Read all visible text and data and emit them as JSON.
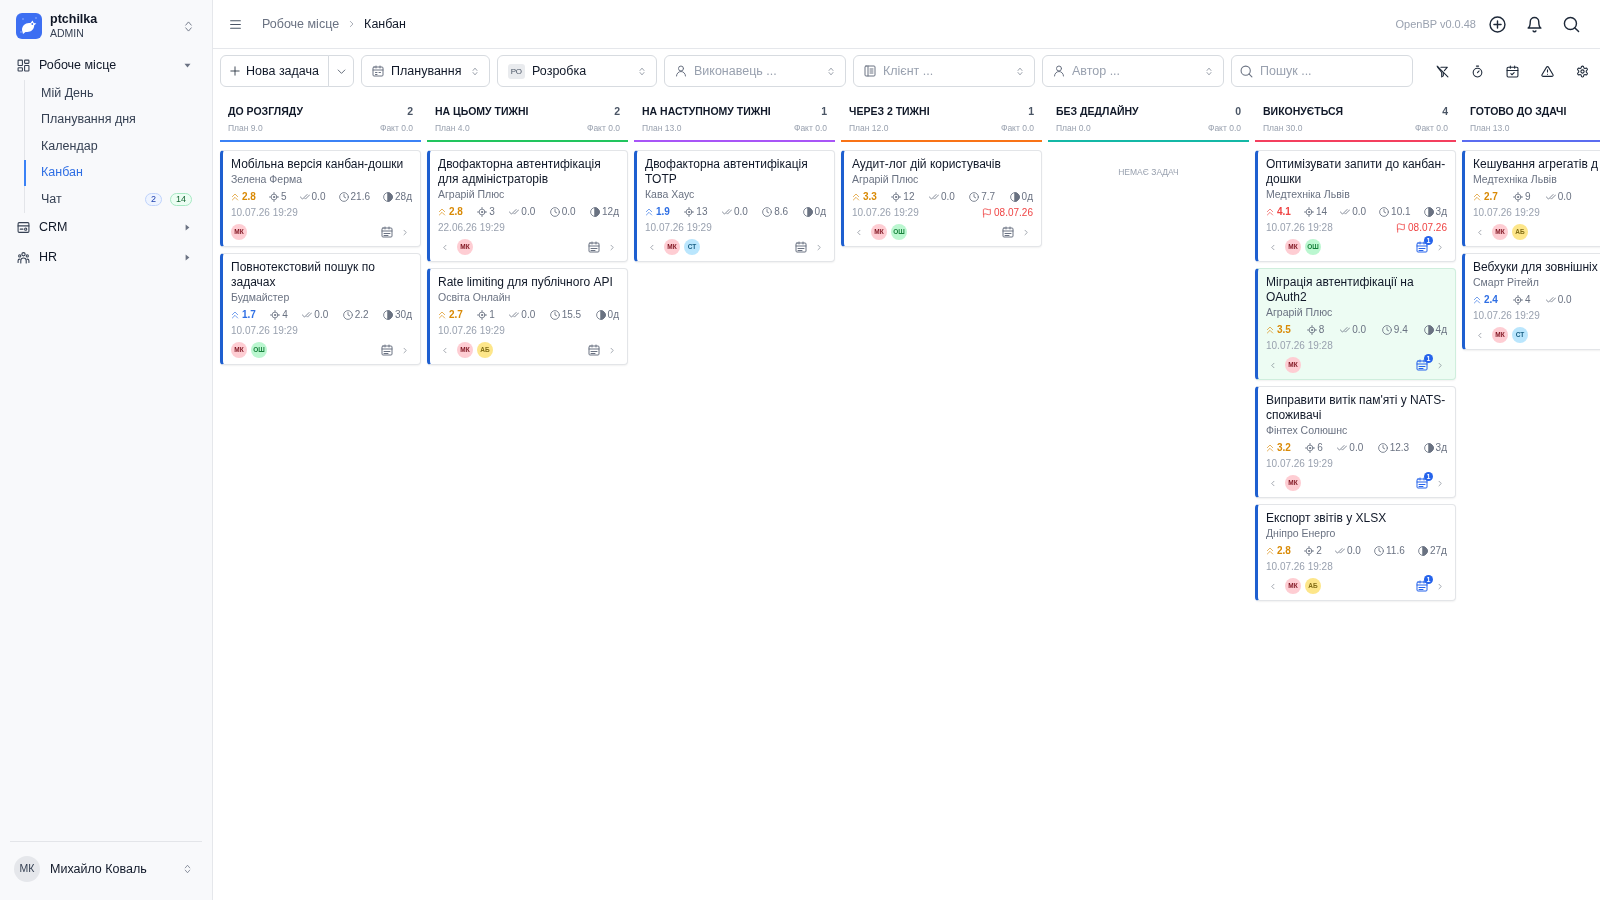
{
  "sidebar": {
    "brand": {
      "name": "ptchilka",
      "role": "ADMIN"
    },
    "nav": [
      {
        "label": "Робоче місце",
        "expanded": true,
        "children": [
          {
            "label": "Мій День",
            "selected": false
          },
          {
            "label": "Планування дня",
            "selected": false
          },
          {
            "label": "Календар",
            "selected": false
          },
          {
            "label": "Канбан",
            "selected": true
          },
          {
            "label": "Чат",
            "selected": false,
            "badges": [
              {
                "text": "2",
                "kind": "info"
              },
              {
                "text": "14",
                "kind": "success"
              }
            ]
          }
        ]
      },
      {
        "label": "CRM",
        "expanded": false
      },
      {
        "label": "HR",
        "expanded": false
      }
    ],
    "user": {
      "initials": "МК",
      "name": "Михайло Коваль"
    }
  },
  "header": {
    "breadcrumbs": [
      "Робоче місце",
      "Канбан"
    ],
    "version": "OpenBP v0.0.48"
  },
  "toolbar": {
    "new_task": "Нова задача",
    "filters": [
      {
        "value": "Планування"
      },
      {
        "badge": "РО",
        "value": "Розробка"
      },
      {
        "placeholder": "Виконавець ..."
      },
      {
        "placeholder": "Клієнт ..."
      },
      {
        "placeholder": "Автор ..."
      }
    ],
    "search": {
      "placeholder": "Пошук ..."
    }
  },
  "columns": [
    {
      "title": "ДО РОЗГЛЯДУ",
      "count": "2",
      "plan": "План 9.0",
      "fact": "Факт 0.0",
      "color": "#3b82f6",
      "cards": [
        {
          "title": "Мобільна версія канбан-дошки",
          "client": "Зелена Ферма",
          "priority": {
            "value": "2.8",
            "kind": "medium"
          },
          "subtasks": "5",
          "done": "0.0",
          "hours": "21.6",
          "days": "28д",
          "date": "10.07.26 19:29",
          "avatars": [
            {
              "initials": "МК",
              "color": "#fecdd3"
            }
          ],
          "prev": false,
          "highlighted": false
        },
        {
          "title": "Повнотекстовий пошук по задачах",
          "client": "Будмайстер",
          "priority": {
            "value": "1.7",
            "kind": "low"
          },
          "subtasks": "4",
          "done": "0.0",
          "hours": "2.2",
          "days": "30д",
          "date": "10.07.26 19:29",
          "avatars": [
            {
              "initials": "МК",
              "color": "#fecdd3"
            },
            {
              "initials": "ОШ",
              "color": "#bbf7d0"
            }
          ],
          "prev": false,
          "highlighted": false
        }
      ]
    },
    {
      "title": "НА ЦЬОМУ ТИЖНІ",
      "count": "2",
      "plan": "План 4.0",
      "fact": "Факт 0.0",
      "color": "#22c55e",
      "cards": [
        {
          "title": "Двофакторна автентифікація для адміністраторів",
          "client": "Аграрій Плюс",
          "priority": {
            "value": "2.8",
            "kind": "medium"
          },
          "subtasks": "3",
          "done": "0.0",
          "hours": "0.0",
          "days": "12д",
          "date": "22.06.26 19:29",
          "avatars": [
            {
              "initials": "МК",
              "color": "#fecdd3"
            }
          ],
          "prev": true,
          "highlighted": false
        },
        {
          "title": "Rate limiting для публічного API",
          "client": "Освіта Онлайн",
          "priority": {
            "value": "2.7",
            "kind": "medium"
          },
          "subtasks": "1",
          "done": "0.0",
          "hours": "15.5",
          "days": "0д",
          "date": "10.07.26 19:29",
          "avatars": [
            {
              "initials": "МК",
              "color": "#fecdd3"
            },
            {
              "initials": "АБ",
              "color": "#fde68a"
            }
          ],
          "prev": true,
          "highlighted": false
        }
      ]
    },
    {
      "title": "НА НАСТУПНОМУ ТИЖНІ",
      "count": "1",
      "plan": "План 13.0",
      "fact": "Факт 0.0",
      "color": "#a855f7",
      "cards": [
        {
          "title": "Двофакторна автентифікація TOTP",
          "client": "Кава Хаус",
          "priority": {
            "value": "1.9",
            "kind": "low"
          },
          "subtasks": "13",
          "done": "0.0",
          "hours": "8.6",
          "days": "0д",
          "date": "10.07.26 19:29",
          "avatars": [
            {
              "initials": "МК",
              "color": "#fecdd3"
            },
            {
              "initials": "СТ",
              "color": "#bae6fd"
            }
          ],
          "prev": true,
          "highlighted": false
        }
      ]
    },
    {
      "title": "ЧЕРЕЗ 2 ТИЖНІ",
      "count": "1",
      "plan": "План 12.0",
      "fact": "Факт 0.0",
      "color": "#f97316",
      "cards": [
        {
          "title": "Аудит-лог дій користувачів",
          "client": "Аграрій Плюс",
          "priority": {
            "value": "3.3",
            "kind": "medium"
          },
          "subtasks": "12",
          "done": "0.0",
          "hours": "7.7",
          "days": "0д",
          "date": "10.07.26 19:29",
          "deadline": "08.07.26",
          "avatars": [
            {
              "initials": "МК",
              "color": "#fecdd3"
            },
            {
              "initials": "ОШ",
              "color": "#bbf7d0"
            }
          ],
          "prev": true,
          "highlighted": false
        }
      ]
    },
    {
      "title": "БЕЗ ДЕДЛАЙНУ",
      "count": "0",
      "plan": "План 0.0",
      "fact": "Факт 0.0",
      "color": "#14b8a6",
      "empty_text": "НЕМАЄ ЗАДАЧ"
    },
    {
      "title": "ВИКОНУЄТЬСЯ",
      "count": "4",
      "plan": "План 30.0",
      "fact": "Факт 0.0",
      "color": "#f43f5e",
      "cards": [
        {
          "title": "Оптимізувати запити до канбан-дошки",
          "client": "Медтехніка Львів",
          "priority": {
            "value": "4.1",
            "kind": "high"
          },
          "subtasks": "14",
          "done": "0.0",
          "hours": "10.1",
          "days": "3д",
          "date": "10.07.26 19:28",
          "deadline": "08.07.26",
          "avatars": [
            {
              "initials": "МК",
              "color": "#fecdd3"
            },
            {
              "initials": "ОШ",
              "color": "#bbf7d0"
            }
          ],
          "prev": true,
          "highlighted": false,
          "calendar_badge": "1"
        },
        {
          "title": "Міграція автентифікації на OAuth2",
          "client": "Аграрій Плюс",
          "priority": {
            "value": "3.5",
            "kind": "medium"
          },
          "subtasks": "8",
          "done": "0.0",
          "hours": "9.4",
          "days": "4д",
          "date": "10.07.26 19:28",
          "avatars": [
            {
              "initials": "МК",
              "color": "#fecdd3"
            }
          ],
          "prev": true,
          "highlighted": true,
          "calendar_badge": "1"
        },
        {
          "title": "Виправити витік пам'яті у NATS-споживачі",
          "client": "Фінтех Солюшнс",
          "priority": {
            "value": "3.2",
            "kind": "medium"
          },
          "subtasks": "6",
          "done": "0.0",
          "hours": "12.3",
          "days": "3д",
          "date": "10.07.26 19:29",
          "avatars": [
            {
              "initials": "МК",
              "color": "#fecdd3"
            }
          ],
          "prev": true,
          "highlighted": false,
          "calendar_badge": "1"
        },
        {
          "title": "Експорт звітів у XLSX",
          "client": "Дніпро Енерго",
          "priority": {
            "value": "2.8",
            "kind": "medium"
          },
          "subtasks": "2",
          "done": "0.0",
          "hours": "11.6",
          "days": "27д",
          "date": "10.07.26 19:28",
          "avatars": [
            {
              "initials": "МК",
              "color": "#fecdd3"
            },
            {
              "initials": "АБ",
              "color": "#fde68a"
            }
          ],
          "prev": true,
          "highlighted": false,
          "calendar_badge": "1"
        }
      ]
    },
    {
      "title": "ГОТОВО ДО ЗДАЧІ",
      "plan": "План 13.0",
      "color": "#5b6cf0",
      "cards": [
        {
          "title": "Кешування агрегатів д",
          "client": "Медтехніка Львів",
          "priority": {
            "value": "2.7",
            "kind": "medium"
          },
          "subtasks": "9",
          "done": "0.0",
          "date": "10.07.26 19:29",
          "avatars": [
            {
              "initials": "МК",
              "color": "#fecdd3"
            },
            {
              "initials": "АБ",
              "color": "#fde68a"
            }
          ],
          "prev": true,
          "highlighted": false
        },
        {
          "title": "Вебхуки для зовнішніх",
          "client": "Смарт Рітейл",
          "priority": {
            "value": "2.4",
            "kind": "low"
          },
          "subtasks": "4",
          "done": "0.0",
          "date": "10.07.26 19:29",
          "avatars": [
            {
              "initials": "МК",
              "color": "#fecdd3"
            },
            {
              "initials": "СТ",
              "color": "#bae6fd"
            }
          ],
          "prev": true,
          "highlighted": false
        }
      ]
    }
  ]
}
